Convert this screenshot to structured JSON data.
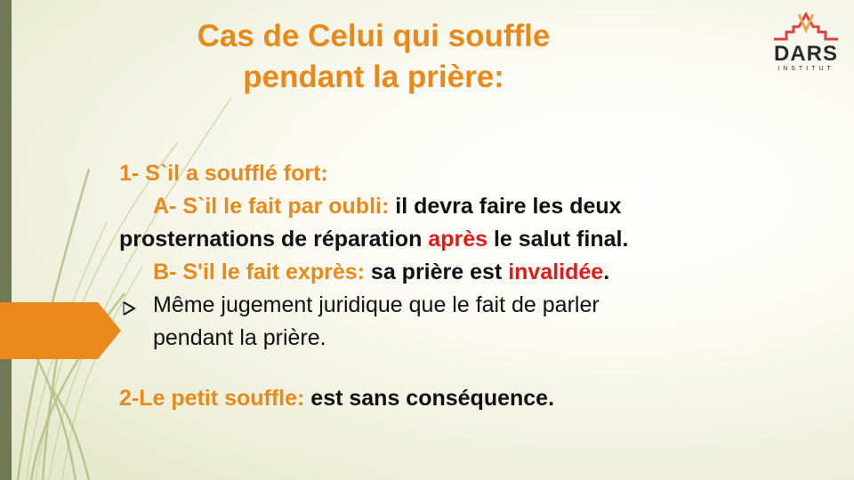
{
  "title": {
    "line1": "Cas de Celui qui souffle",
    "line2": "pendant la prière:"
  },
  "logo": {
    "name": "DARS",
    "subtitle": "INSTITUT"
  },
  "content": {
    "point1_heading": "1- S`il a soufflé fort:",
    "pointA_label": "A- S`il le fait par oubli:",
    "pointA_text": " il devra faire les deux",
    "pointA_text2": "prosternations de réparation ",
    "pointA_highlight": "après",
    "pointA_text3": " le salut final.",
    "pointB_label": "B- S'il le fait exprès:",
    "pointB_text": " sa prière est ",
    "pointB_highlight": "invalidée",
    "pointB_end": ".",
    "bullet_line1": "Même jugement juridique que le fait de parler",
    "bullet_line2": "pendant la prière.",
    "point2_label": "2-Le petit souffle:",
    "point2_text": " est sans conséquence."
  },
  "colors": {
    "orange": "#e8891a",
    "red": "#e21a1a",
    "sidebar": "#6f7a55",
    "logo_red": "#e04040"
  },
  "icons": {
    "bullet": "arrowhead-bullet-icon",
    "logo": "dars-logo-icon"
  }
}
